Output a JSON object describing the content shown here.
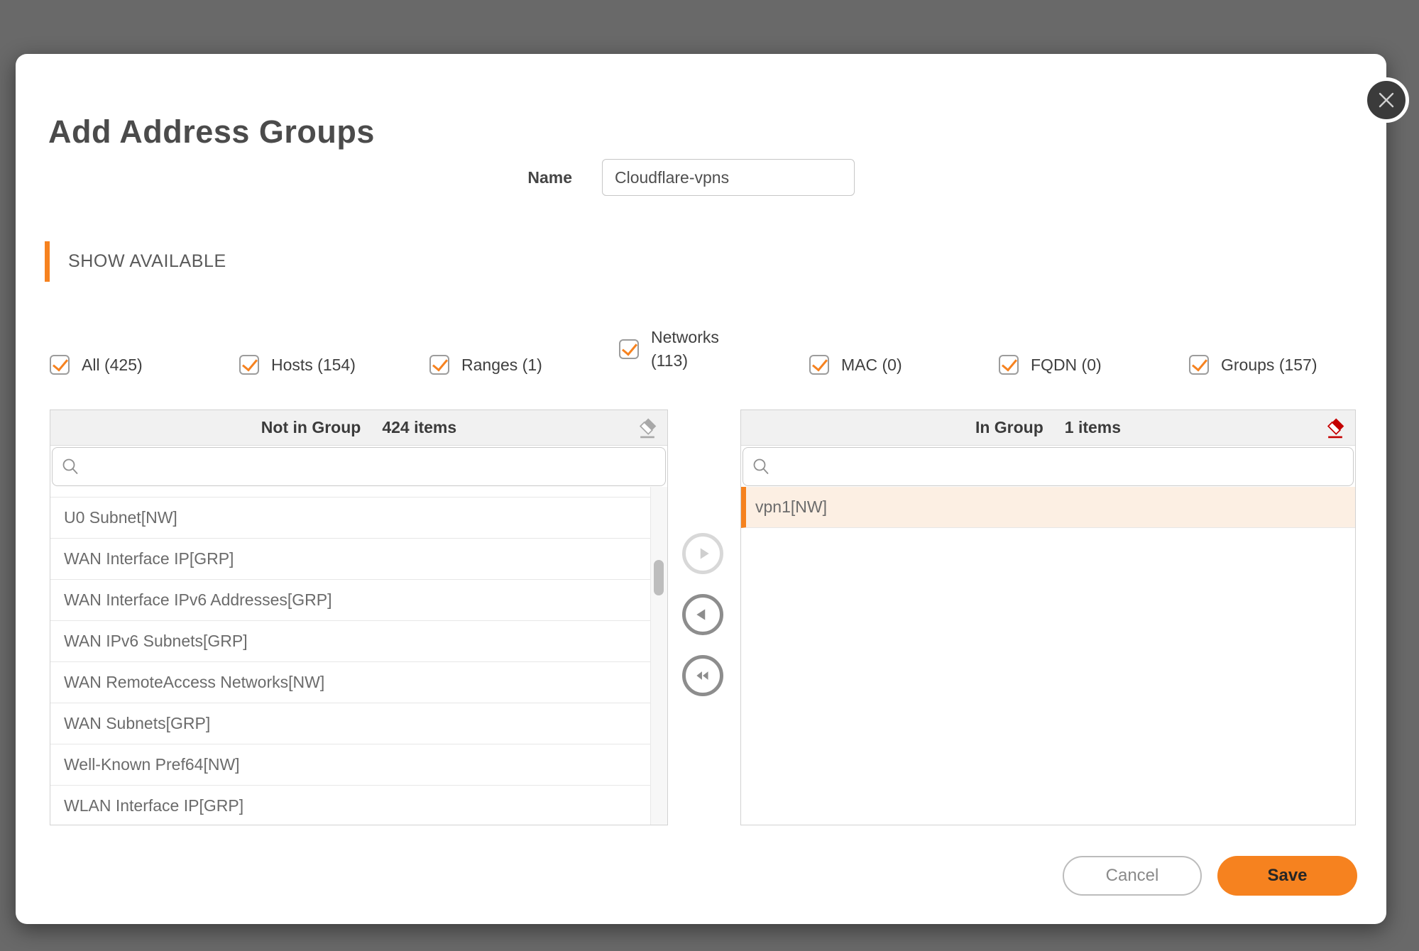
{
  "dialog": {
    "title": "Add Address Groups",
    "name_label": "Name",
    "name_value": "Cloudflare-vpns",
    "section_header": "SHOW AVAILABLE"
  },
  "filters": [
    {
      "label": "All (425)",
      "checked": true
    },
    {
      "label": "Hosts (154)",
      "checked": true
    },
    {
      "label": "Ranges (1)",
      "checked": true
    },
    {
      "label": "Networks (113)",
      "checked": true,
      "lines": [
        "Networks",
        "(113)"
      ]
    },
    {
      "label": "MAC (0)",
      "checked": true
    },
    {
      "label": "FQDN (0)",
      "checked": true
    },
    {
      "label": "Groups (157)",
      "checked": true
    }
  ],
  "not_in_group": {
    "title": "Not in Group",
    "count_label": "424 items",
    "search_value": "",
    "items": [
      "U0 Subnet[NW]",
      "WAN Interface IP[GRP]",
      "WAN Interface IPv6 Addresses[GRP]",
      "WAN IPv6 Subnets[GRP]",
      "WAN RemoteAccess Networks[NW]",
      "WAN Subnets[GRP]",
      "Well-Known Pref64[NW]",
      "WLAN Interface IP[GRP]"
    ]
  },
  "in_group": {
    "title": "In Group",
    "count_label": "1 items",
    "search_value": "",
    "items": [
      "vpn1[NW]"
    ],
    "selected_item": "vpn1[NW]"
  },
  "icons": {
    "close": "x-icon",
    "search": "magnifier-icon",
    "clear_left": "eraser-icon",
    "clear_right": "eraser-icon",
    "move_right": "arrow-right-icon",
    "move_left": "arrow-left-icon",
    "move_all_left": "double-arrow-left-icon"
  },
  "footer": {
    "cancel_label": "Cancel",
    "save_label": "Save"
  },
  "colors": {
    "accent_orange": "#F6821F",
    "selected_row_bg": "#FCEFE3",
    "eraser_red": "#C40000",
    "eraser_gray": "#A8A8A8",
    "overlay_bg": "#696969",
    "enabled_arrow": "#8D8D8D",
    "disabled_arrow": "#D8D8D8"
  }
}
